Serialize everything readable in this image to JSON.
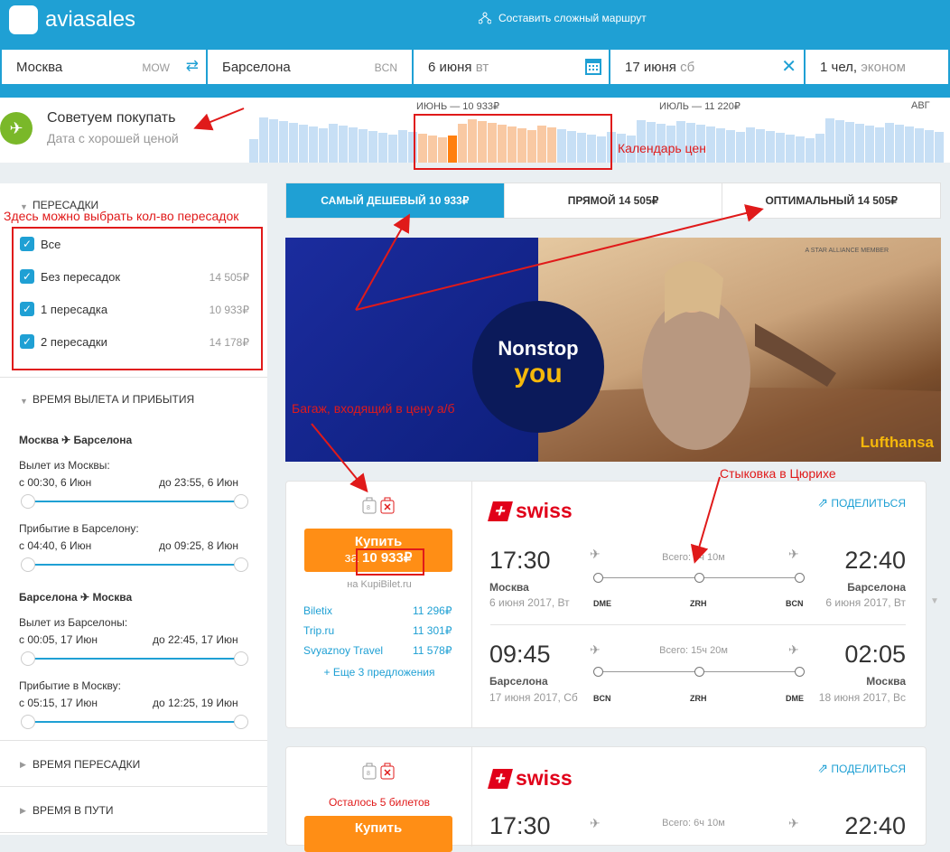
{
  "header": {
    "logo": "aviasales",
    "route_link": "Составить сложный маршрут"
  },
  "search": {
    "origin": "Москва",
    "origin_code": "MOW",
    "destination": "Барселона",
    "destination_code": "BCN",
    "depart_date": "6 июня",
    "depart_wd": "вт",
    "return_date": "17 июня",
    "return_wd": "сб",
    "passengers": "1 чел,",
    "class": "эконом"
  },
  "advise": {
    "title": "Советуем покупать",
    "subtitle": "Дата с хорошей ценой",
    "calendar": {
      "june": "ИЮНЬ — 10 933₽",
      "july": "ИЮЛЬ — 11 220₽",
      "aug": "АВГ"
    }
  },
  "filters": {
    "transfers_title": "ПЕРЕСАДКИ",
    "options": [
      {
        "label": "Все",
        "price": ""
      },
      {
        "label": "Без пересадок",
        "price": "14 505₽"
      },
      {
        "label": "1 пересадка",
        "price": "10 933₽"
      },
      {
        "label": "2 пересадки",
        "price": "14 178₽"
      }
    ],
    "times_title": "ВРЕМЯ ВЫЛЕТА И ПРИБЫТИЯ",
    "outbound": {
      "route_from": "Москва",
      "route_to": "Барселона",
      "dep_label": "Вылет из Москвы:",
      "dep_from": "с 00:30, 6 Июн",
      "dep_to": "до 23:55, 6 Июн",
      "arr_label": "Прибытие в Барселону:",
      "arr_from": "с 04:40, 6 Июн",
      "arr_to": "до 09:25, 8 Июн"
    },
    "inbound": {
      "route_from": "Барселона",
      "route_to": "Москва",
      "dep_label": "Вылет из Барселоны:",
      "dep_from": "с 00:05, 17 Июн",
      "dep_to": "до 22:45, 17 Июн",
      "arr_label": "Прибытие в Москву:",
      "arr_from": "с 05:15, 17 Июн",
      "arr_to": "до 12:25, 19 Июн"
    },
    "transfer_time": "ВРЕМЯ ПЕРЕСАДКИ",
    "travel_time": "ВРЕМЯ В ПУТИ"
  },
  "tabs": [
    {
      "label": "САМЫЙ ДЕШЕВЫЙ 10 933₽"
    },
    {
      "label": "ПРЯМОЙ 14 505₽"
    },
    {
      "label": "ОПТИМАЛЬНЫЙ 14 505₽"
    }
  ],
  "banner": {
    "line1": "Nonstop",
    "line2": "you",
    "brand": "Lufthansa",
    "alliance": "A STAR ALLIANCE MEMBER"
  },
  "ticket1": {
    "buy": "Купить",
    "price_prefix": "за",
    "price": "10 933₽",
    "via": "на KupiBilet.ru",
    "offers": [
      {
        "name": "Biletix",
        "price": "11 296₽"
      },
      {
        "name": "Trip.ru",
        "price": "11 301₽"
      },
      {
        "name": "Svyaznoy Travel",
        "price": "11 578₽"
      }
    ],
    "more": "+ Еще 3 предложения",
    "airline": "swiss",
    "share": "ПОДЕЛИТЬСЯ",
    "out": {
      "dep_time": "17:30",
      "dep_city": "Москва",
      "dep_date": "6 июня 2017, Вт",
      "total": "Всего: 6ч 10м",
      "arr_time": "22:40",
      "arr_city": "Барселона",
      "arr_date": "6 июня 2017, Вт",
      "a1": "DME",
      "a2": "ZRH",
      "a3": "BCN"
    },
    "ret": {
      "dep_time": "09:45",
      "dep_city": "Барселона",
      "dep_date": "17 июня 2017, Сб",
      "total": "Всего: 15ч 20м",
      "arr_time": "02:05",
      "arr_city": "Москва",
      "arr_date": "18 июня 2017, Вс",
      "a1": "BCN",
      "a2": "ZRH",
      "a3": "DME"
    }
  },
  "ticket2": {
    "left": "Осталось 5 билетов",
    "buy": "Купить",
    "airline": "swiss",
    "share": "ПОДЕЛИТЬСЯ",
    "dep_time": "17:30",
    "total": "Всего: 6ч 10м",
    "arr_time": "22:40"
  },
  "annotations": {
    "transfers": "Здесь можно выбрать кол-во пересадок",
    "calendar": "Календарь цен",
    "baggage": "Багаж, входящий в цену а/б",
    "zurich": "Стыковка в Цюрихе"
  },
  "colors": {
    "brand": "#1fa0d4",
    "buy": "#ff8e15",
    "annotation": "#e01a1a",
    "swiss": "#e1001a"
  }
}
